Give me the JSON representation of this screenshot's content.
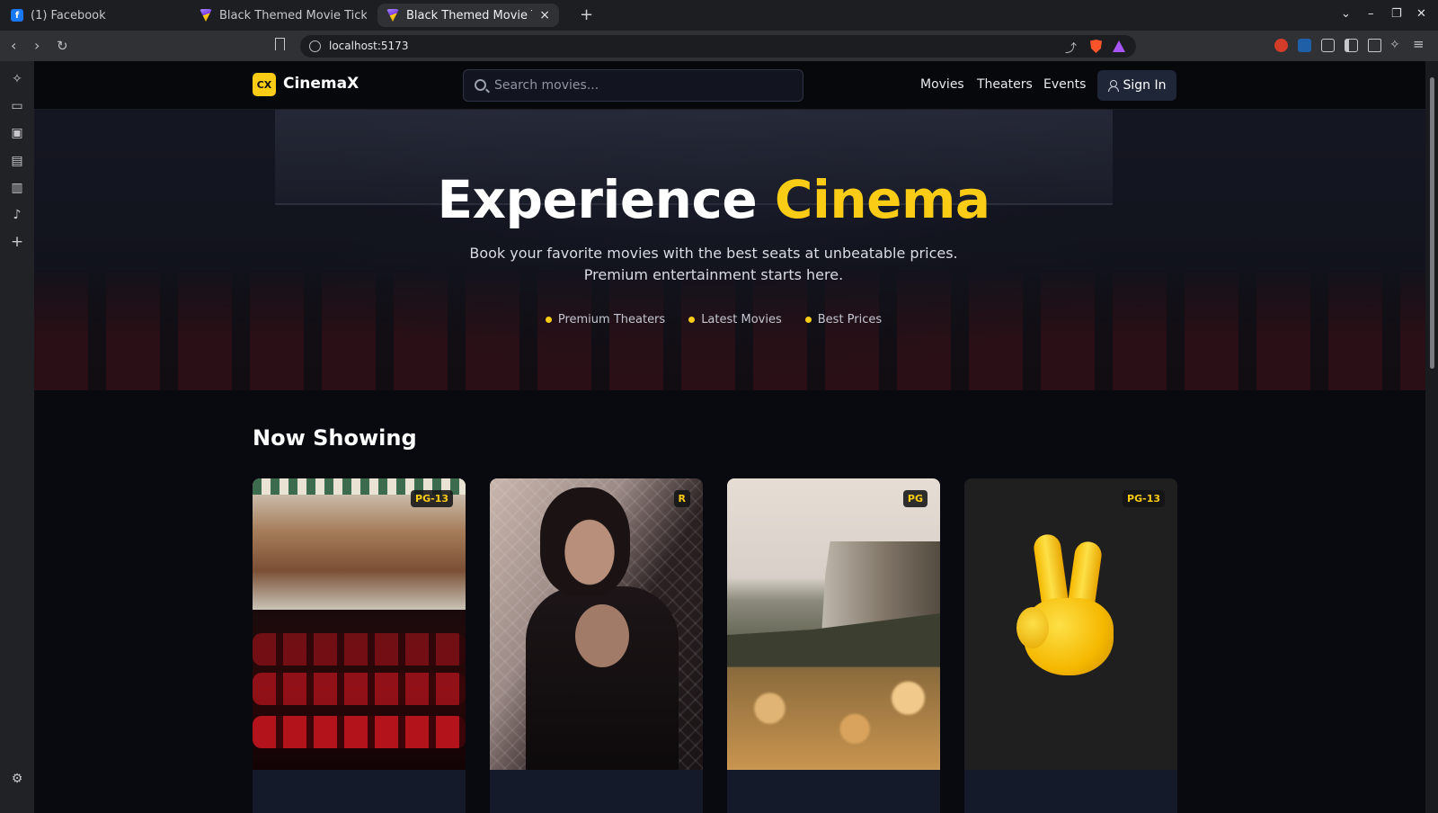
{
  "browser": {
    "tabs": [
      {
        "title": "(1) Facebook",
        "icon": "facebook-icon",
        "active": false
      },
      {
        "title": "Black Themed Movie Ticket B",
        "icon": "vite-icon",
        "active": false
      },
      {
        "title": "Black Themed Movie Ticke",
        "icon": "vite-icon",
        "active": true
      }
    ],
    "new_tab_label": "+",
    "close_tab_label": "×",
    "url": "localhost:5173",
    "window_controls": [
      "⌄",
      "–",
      "❐",
      "✕"
    ]
  },
  "site": {
    "logo_mark": "CX",
    "logo_text": "CinemaX",
    "search_placeholder": "Search movies...",
    "nav_links": [
      "Movies",
      "Theaters",
      "Events"
    ],
    "signin_label": "Sign In"
  },
  "hero": {
    "title_main": "Experience",
    "title_accent": "Cinema",
    "subtitle_line1": "Book your favorite movies with the best seats at unbeatable prices.",
    "subtitle_line2": "Premium entertainment starts here.",
    "features": [
      "Premium Theaters",
      "Latest Movies",
      "Best Prices"
    ]
  },
  "now_showing": {
    "heading": "Now Showing",
    "movies": [
      {
        "rating": "PG-13"
      },
      {
        "rating": "R"
      },
      {
        "rating": "PG"
      },
      {
        "rating": "PG-13"
      }
    ]
  },
  "colors": {
    "accent": "#facc15",
    "background": "#080a10",
    "nav_bg": "#07080c",
    "signin_bg": "#1e2638"
  }
}
